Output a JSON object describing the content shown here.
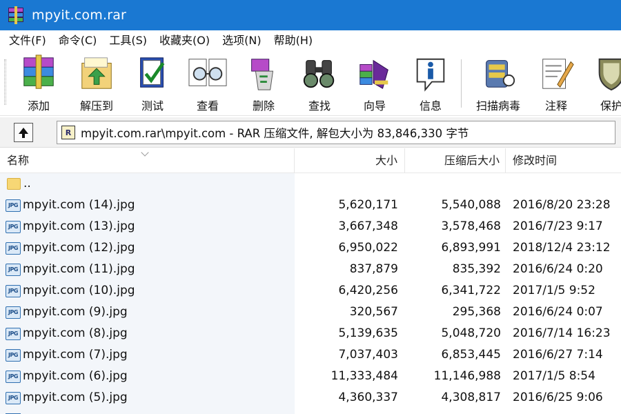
{
  "window": {
    "title": "mpyit.com.rar",
    "app_icon": "winrar-books-icon"
  },
  "menu": [
    {
      "label": "文件(F)"
    },
    {
      "label": "命令(C)"
    },
    {
      "label": "工具(S)"
    },
    {
      "label": "收藏夹(O)"
    },
    {
      "label": "选项(N)"
    },
    {
      "label": "帮助(H)"
    }
  ],
  "toolbar": [
    {
      "label": "添加",
      "icon": "add-archive-icon"
    },
    {
      "label": "解压到",
      "icon": "extract-to-icon"
    },
    {
      "label": "测试",
      "icon": "test-icon"
    },
    {
      "label": "查看",
      "icon": "view-icon"
    },
    {
      "label": "删除",
      "icon": "delete-icon"
    },
    {
      "label": "查找",
      "icon": "find-icon"
    },
    {
      "label": "向导",
      "icon": "wizard-icon"
    },
    {
      "label": "信息",
      "icon": "info-icon"
    },
    {
      "label": "扫描病毒",
      "icon": "virus-scan-icon"
    },
    {
      "label": "注释",
      "icon": "comment-icon"
    },
    {
      "label": "保护",
      "icon": "protect-icon"
    }
  ],
  "address": {
    "path": "mpyit.com.rar\\mpyit.com - RAR 压缩文件, 解包大小为 83,846,330 字节",
    "up_icon": "up-folder-icon"
  },
  "columns": {
    "name": "名称",
    "size": "大小",
    "packed": "压缩后大小",
    "modified": "修改时间"
  },
  "files": [
    {
      "name": "..",
      "size": "",
      "packed": "",
      "modified": "",
      "type": "folder"
    },
    {
      "name": "mpyit.com (14).jpg",
      "size": "5,620,171",
      "packed": "5,540,088",
      "modified": "2016/8/20 23:28",
      "type": "jpg"
    },
    {
      "name": "mpyit.com (13).jpg",
      "size": "3,667,348",
      "packed": "3,578,468",
      "modified": "2016/7/23 9:17",
      "type": "jpg"
    },
    {
      "name": "mpyit.com (12).jpg",
      "size": "6,950,022",
      "packed": "6,893,991",
      "modified": "2018/12/4 23:12",
      "type": "jpg"
    },
    {
      "name": "mpyit.com (11).jpg",
      "size": "837,879",
      "packed": "835,392",
      "modified": "2016/6/24 0:20",
      "type": "jpg"
    },
    {
      "name": "mpyit.com (10).jpg",
      "size": "6,420,256",
      "packed": "6,341,722",
      "modified": "2017/1/5 9:52",
      "type": "jpg"
    },
    {
      "name": "mpyit.com (9).jpg",
      "size": "320,567",
      "packed": "295,368",
      "modified": "2016/6/24 0:07",
      "type": "jpg"
    },
    {
      "name": "mpyit.com (8).jpg",
      "size": "5,139,635",
      "packed": "5,048,720",
      "modified": "2016/7/14 16:23",
      "type": "jpg"
    },
    {
      "name": "mpyit.com (7).jpg",
      "size": "7,037,403",
      "packed": "6,853,445",
      "modified": "2016/6/27 7:14",
      "type": "jpg"
    },
    {
      "name": "mpyit.com (6).jpg",
      "size": "11,333,484",
      "packed": "11,146,988",
      "modified": "2017/1/5 8:54",
      "type": "jpg"
    },
    {
      "name": "mpyit.com (5).jpg",
      "size": "4,360,337",
      "packed": "4,308,817",
      "modified": "2016/6/25 9:06",
      "type": "jpg"
    }
  ],
  "colors": {
    "titlebar": "#1a78d2",
    "name_column_bg": "#f3f6fa"
  }
}
